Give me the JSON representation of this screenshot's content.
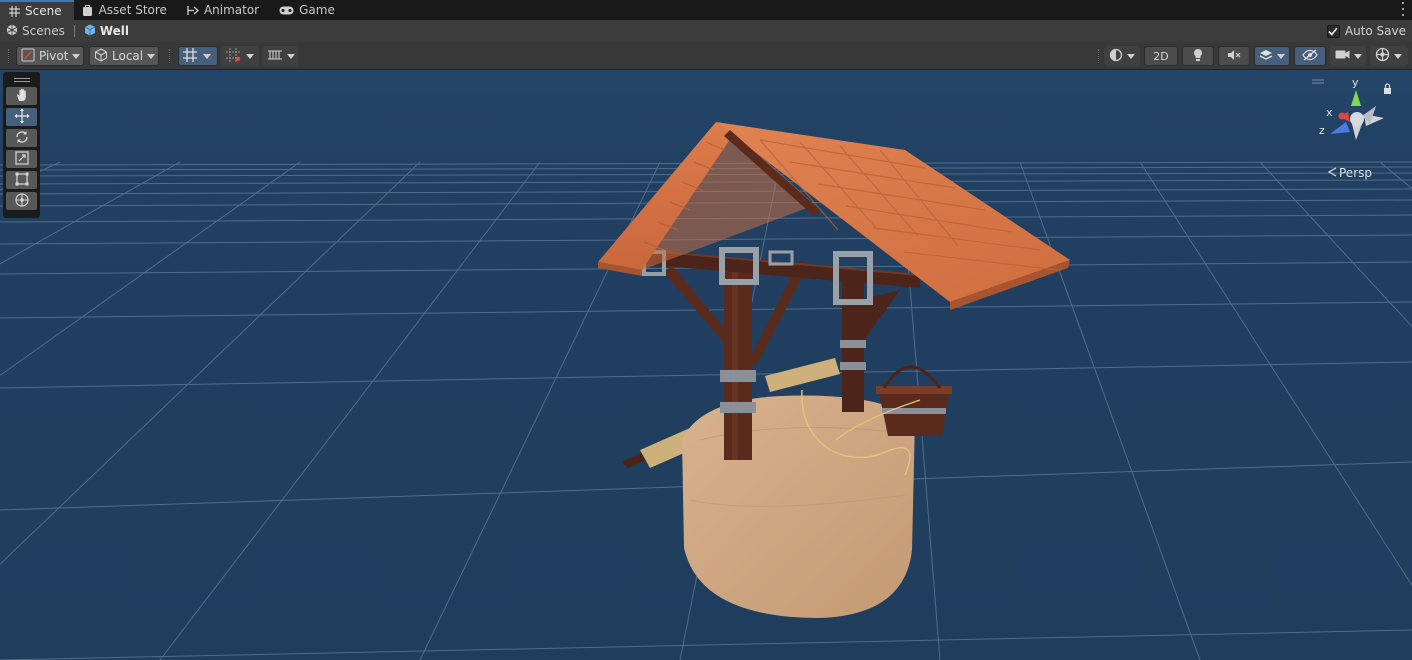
{
  "tabs": [
    {
      "label": "Scene",
      "icon": "hash-icon",
      "active": true
    },
    {
      "label": "Asset Store",
      "icon": "bag-icon",
      "active": false
    },
    {
      "label": "Animator",
      "icon": "animator-icon",
      "active": false
    },
    {
      "label": "Game",
      "icon": "gamepad-icon",
      "active": false
    }
  ],
  "breadcrumb": {
    "root": "Scenes",
    "current": "Well"
  },
  "autosave": {
    "label": "Auto Save",
    "checked": true
  },
  "toolbar": {
    "pivot_label": "Pivot",
    "local_label": "Local",
    "mode_2d_label": "2D"
  },
  "scene": {
    "projection_label": "Persp",
    "axis_x": "x",
    "axis_y": "y",
    "axis_z": "z",
    "background_color": "#1f3d5d",
    "grid_color": "#5d7a96"
  },
  "colors": {
    "accent": "#3a79bb",
    "roof": "#d9774a",
    "wood": "#5a2b1c",
    "stone": "#c9a07c",
    "axis_x": "#e0443a",
    "axis_y": "#7fd957",
    "axis_z": "#4a7be0"
  }
}
